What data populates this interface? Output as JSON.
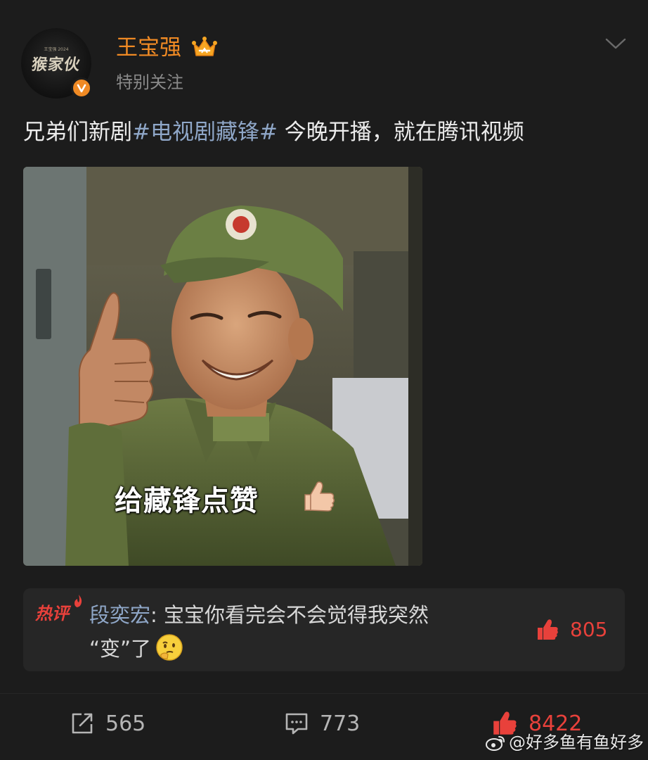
{
  "header": {
    "avatar_text": "猴家伙",
    "avatar_small_text": "王宝强 2024",
    "username": "王宝强",
    "subtitle": "特别关注",
    "vip_icon": "crown-icon",
    "verified_icon": "verified-v-icon",
    "menu_icon": "chevron-down-icon"
  },
  "post": {
    "text_before": "兄弟们新剧",
    "hashtag": "#电视剧藏锋#",
    "text_after": " 今晚开播，就在腾讯视频",
    "image": {
      "caption": "给藏锋点赞",
      "caption_icon": "thumbs-up-icon"
    }
  },
  "hot_comment": {
    "tag": "热评",
    "author": "段奕宏",
    "separator": ": ",
    "text_line1": "宝宝你看完会不会觉得我突然",
    "text_line2": "“变”了",
    "emoji": "thinking-face-icon",
    "like_count": "805"
  },
  "actions": {
    "share_count": "565",
    "comment_count": "773",
    "like_count": "8422"
  },
  "watermark": "@好多鱼有鱼好多",
  "colors": {
    "accent": "#f08a24",
    "like_red": "#e8413b",
    "hashtag_blue": "#8fa7c8",
    "background": "#1c1c1c"
  }
}
